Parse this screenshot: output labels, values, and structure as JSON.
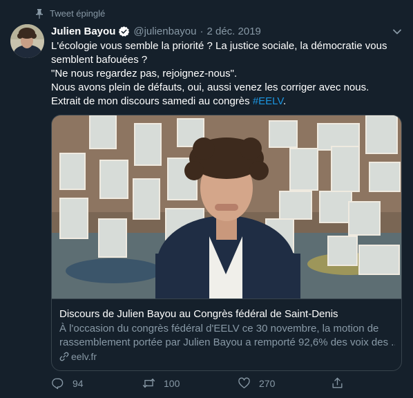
{
  "pinned": {
    "label": "Tweet épinglé",
    "icon": "pin-icon"
  },
  "author": {
    "name": "Julien Bayou",
    "handle": "@julienbayou",
    "separator": "·",
    "date": "2 déc. 2019",
    "verified": true
  },
  "text_lines": [
    "L'écologie vous semble la priorité ? La justice sociale, la démocratie vous",
    "semblent bafouées ?",
    "\"Ne nous regardez pas, rejoignez-nous\".",
    "Nous avons plein de défauts, oui, aussi venez les corriger avec nous."
  ],
  "last_line": {
    "text": "Extrait de mon discours samedi au congrès ",
    "hashtag": "#EELV",
    "end": "."
  },
  "card": {
    "title": "Discours de Julien Bayou au Congrès fédéral de Saint-Denis",
    "description_lines": [
      "À l'occasion du congrès fédéral d'EELV ce 30 novembre, la motion de",
      "rassemblement portée par Julien Bayou a remporté 92,6% des voix des ..."
    ],
    "domain": "eelv.fr"
  },
  "actions": {
    "replies": "94",
    "retweets": "100",
    "likes": "270"
  },
  "colors": {
    "background": "#15202b",
    "accent": "#1b95e0",
    "muted": "#8899a6",
    "border": "#38444d",
    "verified": "#ffffff"
  }
}
